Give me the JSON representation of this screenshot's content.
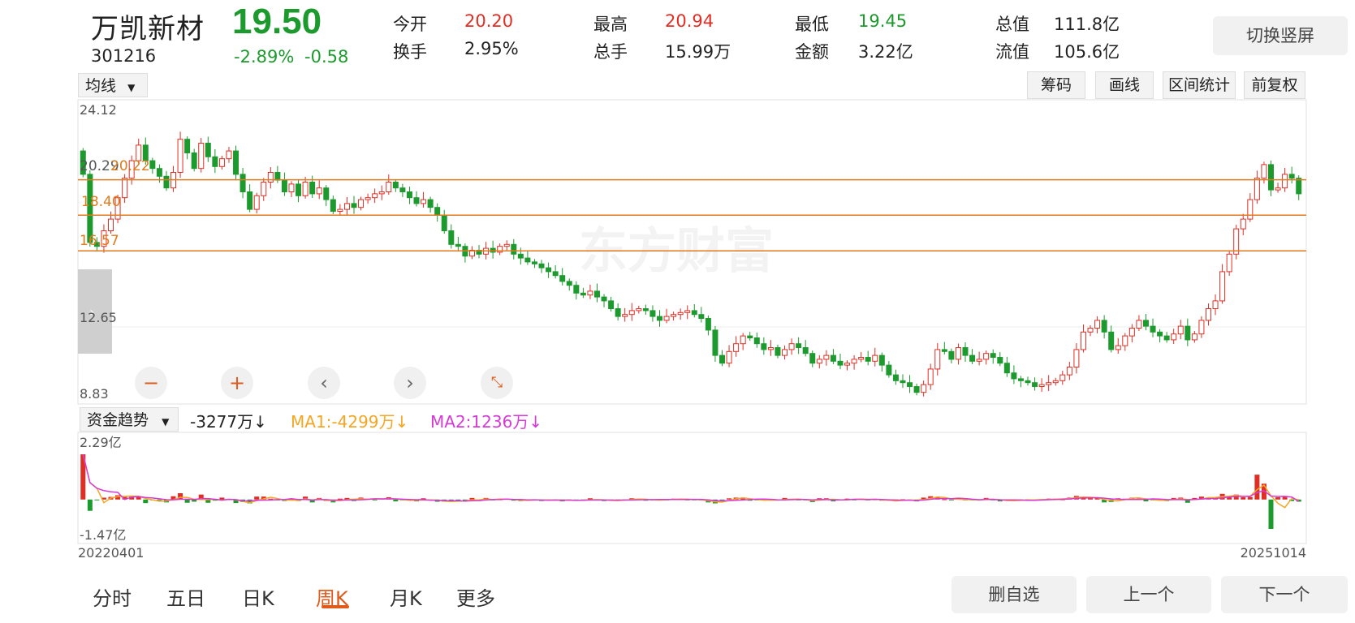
{
  "header": {
    "name": "万凯新材",
    "code": "301216",
    "price": "19.50",
    "change_pct": "-2.89%",
    "change_abs": "-0.58",
    "quote": [
      {
        "label": "今开",
        "value": "20.20",
        "color": "#e02e24"
      },
      {
        "label": "换手",
        "value": "2.95%",
        "color": "#222222"
      },
      {
        "label": "最高",
        "value": "20.94",
        "color": "#e02e24"
      },
      {
        "label": "总手",
        "value": "15.99万",
        "color": "#222222"
      },
      {
        "label": "最低",
        "value": "19.45",
        "color": "#1d9a2e"
      },
      {
        "label": "金额",
        "value": "3.22亿",
        "color": "#222222"
      },
      {
        "label": "总值",
        "value": "111.8亿",
        "color": "#222222"
      },
      {
        "label": "流值",
        "value": "105.6亿",
        "color": "#222222"
      }
    ],
    "switch_button": "切换竖屏"
  },
  "toolbar": {
    "indicator_select": "均线",
    "buttons": [
      "筹码",
      "画线",
      "区间统计",
      "前复权"
    ]
  },
  "main_chart": {
    "watermark": "东方财富",
    "ytick_top": "24.12",
    "ytick_mid": "12.65",
    "ytick_bottom": "8.83",
    "hline_labels": [
      "20.22",
      "18.40",
      "16.57"
    ],
    "hline_label_left": "20.29"
  },
  "sub_chart": {
    "indicator_select": "资金趋势",
    "value": "-3277万↓",
    "ma1": "MA1:-4299万↓",
    "ma2": "MA2:1236万↓",
    "ytick_top": "2.29亿",
    "ytick_bottom": "-1.47亿",
    "date_start": "20220401",
    "date_end": "20251014"
  },
  "tabs": [
    "分时",
    "五日",
    "日K",
    "周K",
    "月K",
    "更多"
  ],
  "active_tab": "周K",
  "bottom_buttons": [
    "删自选",
    "上一个",
    "下一个"
  ],
  "colors": {
    "up": "#e02e24",
    "down": "#1d9a2e",
    "ma1": "#f5a623",
    "ma2": "#d63ad6",
    "hline": "#e07a1c",
    "accent": "#e05a1c"
  },
  "chart_data": [
    {
      "type": "candlestick",
      "title": "",
      "ylim": [
        8.83,
        24.12
      ],
      "x_range": [
        "20220401",
        "20251014"
      ],
      "reference_lines": [
        20.22,
        18.4,
        16.57
      ],
      "closes": [
        20.5,
        17.0,
        16.8,
        17.6,
        18.2,
        19.3,
        20.3,
        21.2,
        22.0,
        21.2,
        20.8,
        20.4,
        19.8,
        20.6,
        22.3,
        21.6,
        20.8,
        22.1,
        21.4,
        20.9,
        21.3,
        21.7,
        20.5,
        19.6,
        18.7,
        19.4,
        20.1,
        20.6,
        20.2,
        19.6,
        20.0,
        19.4,
        20.1,
        19.5,
        19.8,
        19.2,
        18.6,
        18.7,
        19.0,
        18.8,
        19.2,
        19.3,
        19.5,
        19.6,
        20.1,
        19.8,
        19.6,
        19.3,
        19.0,
        19.2,
        18.8,
        18.4,
        17.6,
        16.9,
        16.8,
        16.3,
        16.6,
        16.4,
        16.7,
        16.5,
        16.8,
        16.9,
        16.4,
        16.2,
        16.0,
        15.9,
        15.7,
        15.5,
        15.3,
        15.0,
        14.8,
        14.4,
        14.3,
        14.5,
        14.2,
        14.0,
        13.6,
        13.2,
        13.3,
        13.5,
        13.6,
        13.5,
        13.2,
        13.0,
        13.2,
        13.3,
        13.4,
        13.5,
        13.3,
        13.1,
        12.5,
        11.2,
        10.8,
        11.4,
        11.8,
        12.2,
        12.1,
        11.8,
        11.5,
        11.6,
        11.2,
        11.5,
        11.8,
        11.6,
        11.3,
        10.8,
        11.0,
        11.2,
        10.9,
        10.7,
        10.8,
        11.0,
        11.1,
        10.9,
        11.2,
        10.7,
        10.2,
        9.9,
        9.8,
        9.6,
        9.3,
        9.7,
        10.5,
        11.5,
        11.4,
        11.0,
        11.6,
        11.2,
        10.9,
        11.0,
        11.3,
        11.1,
        10.8,
        10.3,
        10.0,
        9.9,
        9.8,
        9.6,
        9.7,
        9.8,
        9.9,
        10.2,
        10.6,
        11.5,
        12.4,
        12.6,
        13.0,
        12.4,
        11.5,
        11.7,
        12.2,
        12.6,
        13.0,
        12.7,
        12.4,
        12.2,
        12.0,
        12.3,
        12.7,
        12.0,
        12.3,
        13.0,
        13.6,
        14.0,
        15.5,
        16.4,
        17.7,
        18.2,
        19.2,
        20.3,
        21.0,
        19.7,
        19.8,
        20.5,
        20.3,
        19.5
      ]
    },
    {
      "type": "bar",
      "title": "资金趋势",
      "ylim": [
        -1.47,
        2.29
      ],
      "series": [
        {
          "name": "MA1"
        },
        {
          "name": "MA2"
        }
      ],
      "note_units": "亿"
    }
  ]
}
